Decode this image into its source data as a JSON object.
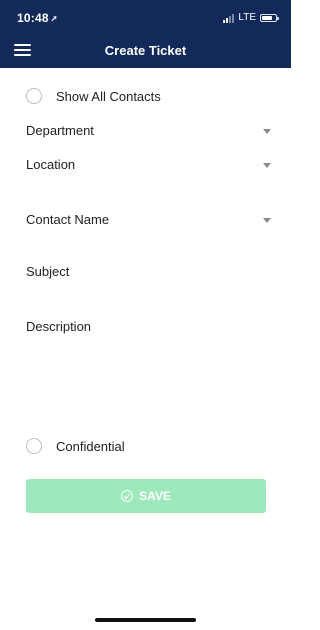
{
  "status_bar": {
    "time": "10:48",
    "network": "LTE",
    "icons": [
      "location-arrow-icon",
      "signal-icon",
      "battery-icon"
    ]
  },
  "header": {
    "title": "Create Ticket",
    "menu_icon": "hamburger-menu-icon",
    "background_color": "#13295a"
  },
  "form": {
    "show_all_contacts_label": "Show All Contacts",
    "department_label": "Department",
    "location_label": "Location",
    "contact_name_label": "Contact Name",
    "subject_label": "Subject",
    "description_label": "Description",
    "confidential_label": "Confidential"
  },
  "actions": {
    "save_label": "SAVE",
    "save_color": "#9ee9bc"
  }
}
